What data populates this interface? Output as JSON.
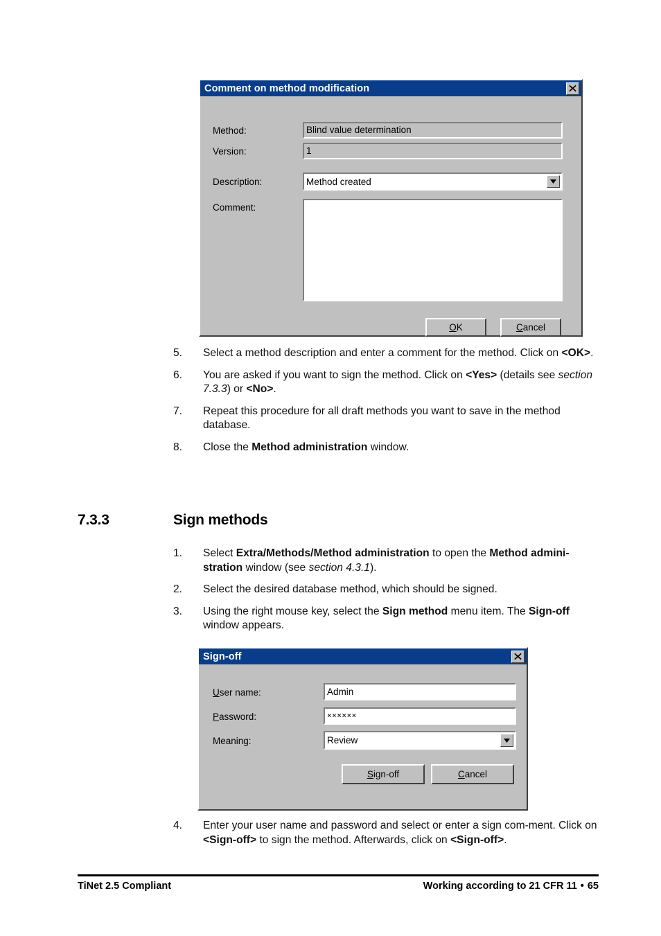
{
  "dialog_comment": {
    "title": "Comment on method modification",
    "close_icon": "close-icon",
    "fields": {
      "method_label": "Method:",
      "method_value": "Blind value determination",
      "version_label": "Version:",
      "version_value": "1",
      "description_label": "Description:",
      "description_value": "Method created",
      "comment_label": "Comment:",
      "comment_value": ""
    },
    "buttons": {
      "ok": "OK",
      "ok_accel": "O",
      "cancel": "Cancel",
      "cancel_accel": "C"
    }
  },
  "dialog_signoff": {
    "title": "Sign-off",
    "close_icon": "close-icon",
    "fields": {
      "username_label": "User name:",
      "username_accel": "U",
      "username_value": "Admin",
      "password_label": "Password:",
      "password_accel": "P",
      "password_value": "××××××",
      "meaning_label": "Meaning:",
      "meaning_value": "Review"
    },
    "buttons": {
      "signoff": "Sign-off",
      "signoff_accel": "S",
      "cancel": "Cancel",
      "cancel_accel": "C"
    }
  },
  "steps_upper": [
    {
      "num": "5.",
      "html": "Select a method description and enter a comment for the method. Click on <b>&lt;OK&gt;</b>."
    },
    {
      "num": "6.",
      "html": "You are asked if you want to sign the method. Click on <b>&lt;Yes&gt;</b> (details see <i>section 7.3.3</i>) or <b>&lt;No&gt;</b>."
    },
    {
      "num": "7.",
      "html": "Repeat this procedure for all draft methods you want to save in the method database."
    },
    {
      "num": "8.",
      "html": "Close the <b>Method administration</b> window."
    }
  ],
  "section": {
    "number": "7.3.3",
    "title": "Sign methods"
  },
  "steps_mid": [
    {
      "num": "1.",
      "html": "Select <b>Extra/Methods/Method administration</b> to open the <b>Method admini-stration</b> window (see <i>section 4.3.1</i>)."
    },
    {
      "num": "2.",
      "html": "Select the desired database method, which should be signed."
    },
    {
      "num": "3.",
      "html": "Using the right mouse key, select the <b>Sign method</b> menu item. The <b>Sign-off</b> window appears."
    }
  ],
  "steps_lower": [
    {
      "num": "4.",
      "html": "Enter your user name and password and select or enter a sign com-ment. Click on <b>&lt;Sign-off&gt;</b> to sign the method. Afterwards, click on <b>&lt;Sign-off&gt;</b>."
    }
  ],
  "footer": {
    "left": "TiNet 2.5 Compliant",
    "right_text": "Working according to 21 CFR 11",
    "bullet": "•",
    "page_number": "65"
  }
}
